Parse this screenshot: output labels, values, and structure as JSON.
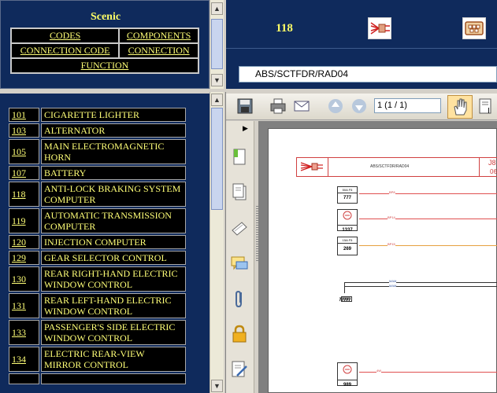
{
  "top_left": {
    "title": "Scenic",
    "menu": [
      "CODES",
      "COMPONENTS",
      "CONNECTION CODE",
      "CONNECTION",
      "FUNCTION"
    ]
  },
  "top_right": {
    "number": "118",
    "path_value": "ABS/SCTFDR/RAD04"
  },
  "components": [
    {
      "code": "101",
      "name": "CIGARETTE LIGHTER"
    },
    {
      "code": "103",
      "name": "ALTERNATOR"
    },
    {
      "code": "105",
      "name": "MAIN ELECTROMAGNETIC HORN"
    },
    {
      "code": "107",
      "name": "BATTERY"
    },
    {
      "code": "118",
      "name": "ANTI-LOCK BRAKING SYSTEM COMPUTER"
    },
    {
      "code": "119",
      "name": "AUTOMATIC TRANSMISSION COMPUTER"
    },
    {
      "code": "120",
      "name": "INJECTION COMPUTER"
    },
    {
      "code": "129",
      "name": "GEAR SELECTOR CONTROL"
    },
    {
      "code": "130",
      "name": "REAR RIGHT-HAND ELECTRIC WINDOW CONTROL"
    },
    {
      "code": "131",
      "name": "REAR LEFT-HAND ELECTRIC WINDOW CONTROL"
    },
    {
      "code": "133",
      "name": "PASSENGER'S SIDE ELECTRIC WINDOW CONTROL"
    },
    {
      "code": "134",
      "name": "ELECTRIC REAR-VIEW MIRROR CONTROL"
    }
  ],
  "viewer": {
    "page_field": "1 (1 / 1)",
    "diagram_header": "ABS/SCTFDR/RAD04",
    "diagram_header_right_top": "J8",
    "diagram_header_right_bottom": "06",
    "connectors": [
      {
        "code": "777",
        "label": "50A  F5",
        "wire": "BP8"
      },
      {
        "code": "1337",
        "label": "",
        "wire": "BP14"
      },
      {
        "code": "269",
        "label": "15A  F5",
        "wire": "BP15"
      },
      {
        "code": "989",
        "label": "",
        "wire": "4W"
      }
    ],
    "ground_label": "MAM",
    "ground_wires": [
      "MAM",
      "MAM"
    ]
  },
  "colors": {
    "navy": "#0f2a5c",
    "yellow": "#ffff77",
    "wire_red": "#e05050",
    "wire_orange": "#e6a040"
  }
}
